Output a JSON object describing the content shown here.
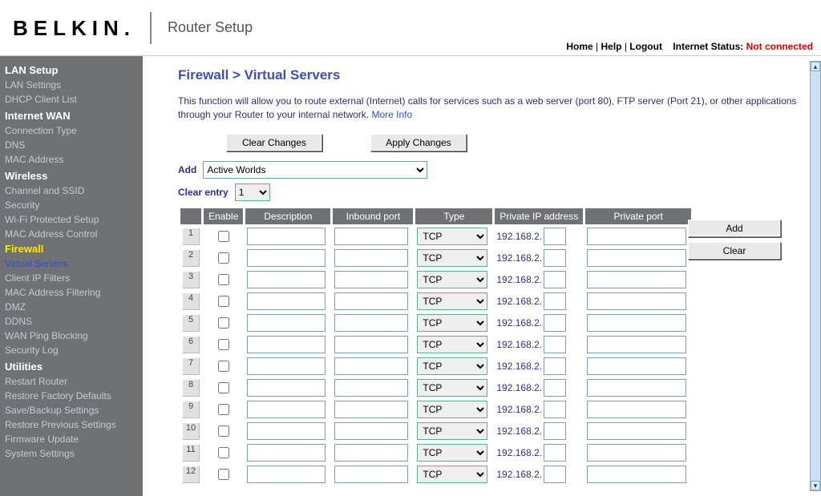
{
  "header": {
    "logo": "BELKIN",
    "title": "Router Setup",
    "links": {
      "home": "Home",
      "help": "Help",
      "logout": "Logout"
    },
    "status_label": "Internet Status:",
    "status_value": "Not connected"
  },
  "sidebar": [
    {
      "type": "section",
      "label": "LAN Setup"
    },
    {
      "type": "item",
      "label": "LAN Settings"
    },
    {
      "type": "item",
      "label": "DHCP Client List"
    },
    {
      "type": "section",
      "label": "Internet WAN"
    },
    {
      "type": "item",
      "label": "Connection Type"
    },
    {
      "type": "item",
      "label": "DNS"
    },
    {
      "type": "item",
      "label": "MAC Address"
    },
    {
      "type": "section",
      "label": "Wireless"
    },
    {
      "type": "item",
      "label": "Channel and SSID"
    },
    {
      "type": "item",
      "label": "Security"
    },
    {
      "type": "item",
      "label": "Wi-Fi Protected Setup"
    },
    {
      "type": "item",
      "label": "MAC Address Control"
    },
    {
      "type": "active-section",
      "label": "Firewall"
    },
    {
      "type": "active",
      "label": "Virtual Servers"
    },
    {
      "type": "item",
      "label": "Client IP Filters"
    },
    {
      "type": "item",
      "label": "MAC Address Filtering"
    },
    {
      "type": "item",
      "label": "DMZ"
    },
    {
      "type": "item",
      "label": "DDNS"
    },
    {
      "type": "item",
      "label": "WAN Ping Blocking"
    },
    {
      "type": "item",
      "label": "Security Log"
    },
    {
      "type": "section",
      "label": "Utilities"
    },
    {
      "type": "item",
      "label": "Restart Router"
    },
    {
      "type": "item",
      "label": "Restore Factory Defaults"
    },
    {
      "type": "item",
      "label": "Save/Backup Settings"
    },
    {
      "type": "item",
      "label": "Restore Previous Settings"
    },
    {
      "type": "item",
      "label": "Firmware Update"
    },
    {
      "type": "item",
      "label": "System Settings"
    }
  ],
  "page": {
    "title": "Firewall > Virtual Servers",
    "desc": "This function will allow you to route external (Internet) calls for services such as a web server (port 80), FTP server (Port 21), or other applications through your Router to your internal network.",
    "more_info": "More Info",
    "clear_changes": "Clear Changes",
    "apply_changes": "Apply Changes",
    "add_label": "Add",
    "add_select": "Active Worlds",
    "add_button": "Add",
    "clear_entry_label": "Clear entry",
    "clear_entry_value": "1",
    "clear_button": "Clear",
    "columns": {
      "enable": "Enable",
      "description": "Description",
      "inbound": "Inbound port",
      "type": "Type",
      "private_ip": "Private IP address",
      "private_port": "Private port"
    },
    "type_option": "TCP",
    "ip_prefix": "192.168.2.",
    "rows": [
      1,
      2,
      3,
      4,
      5,
      6,
      7,
      8,
      9,
      10,
      11,
      12
    ]
  }
}
